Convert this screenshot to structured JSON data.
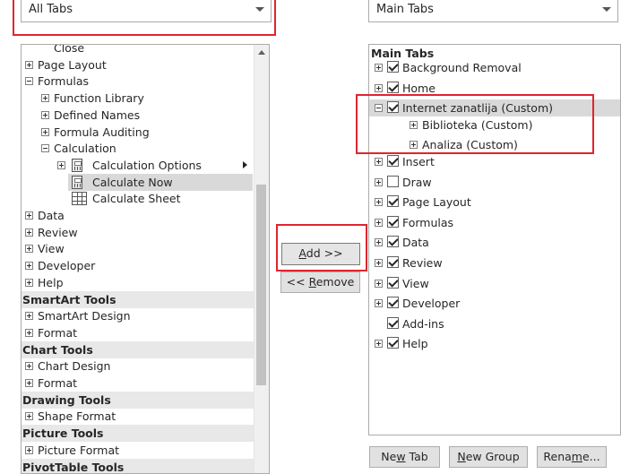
{
  "left_dropdown": {
    "value": "All Tabs"
  },
  "right_dropdown": {
    "value": "Main Tabs"
  },
  "left_tree": [
    {
      "kind": "item",
      "level": 1,
      "label": "Close",
      "expander": "none",
      "cut": true
    },
    {
      "kind": "item",
      "level": 0,
      "label": "Page Layout",
      "expander": "plus"
    },
    {
      "kind": "item",
      "level": 0,
      "label": "Formulas",
      "expander": "minus"
    },
    {
      "kind": "item",
      "level": 1,
      "label": "Function Library",
      "expander": "plus"
    },
    {
      "kind": "item",
      "level": 1,
      "label": "Defined Names",
      "expander": "plus"
    },
    {
      "kind": "item",
      "level": 1,
      "label": "Formula Auditing",
      "expander": "plus"
    },
    {
      "kind": "item",
      "level": 1,
      "label": "Calculation",
      "expander": "minus"
    },
    {
      "kind": "cmd",
      "level": 2,
      "label": "Calculation Options",
      "icon": "calculator-icon",
      "expander": "plus",
      "submenu": true
    },
    {
      "kind": "cmd",
      "level": 2,
      "label": "Calculate Now",
      "icon": "calculator-icon",
      "selected": true
    },
    {
      "kind": "cmd",
      "level": 2,
      "label": "Calculate Sheet",
      "icon": "sheet-icon"
    },
    {
      "kind": "item",
      "level": 0,
      "label": "Data",
      "expander": "plus"
    },
    {
      "kind": "item",
      "level": 0,
      "label": "Review",
      "expander": "plus"
    },
    {
      "kind": "item",
      "level": 0,
      "label": "View",
      "expander": "plus"
    },
    {
      "kind": "item",
      "level": 0,
      "label": "Developer",
      "expander": "plus"
    },
    {
      "kind": "item",
      "level": 0,
      "label": "Help",
      "expander": "plus"
    },
    {
      "kind": "group",
      "label": "SmartArt Tools"
    },
    {
      "kind": "item",
      "level": 0,
      "label": "SmartArt Design",
      "expander": "plus"
    },
    {
      "kind": "item",
      "level": 0,
      "label": "Format",
      "expander": "plus"
    },
    {
      "kind": "group",
      "label": "Chart Tools"
    },
    {
      "kind": "item",
      "level": 0,
      "label": "Chart Design",
      "expander": "plus"
    },
    {
      "kind": "item",
      "level": 0,
      "label": "Format",
      "expander": "plus"
    },
    {
      "kind": "group",
      "label": "Drawing Tools"
    },
    {
      "kind": "item",
      "level": 0,
      "label": "Shape Format",
      "expander": "plus"
    },
    {
      "kind": "group",
      "label": "Picture Tools"
    },
    {
      "kind": "item",
      "level": 0,
      "label": "Picture Format",
      "expander": "plus"
    },
    {
      "kind": "group",
      "label": "PivotTable Tools"
    }
  ],
  "right_tree_header": "Main Tabs",
  "right_tree": [
    {
      "label": "Background Removal",
      "level": 0,
      "expander": "plus",
      "checked": true
    },
    {
      "label": "Home",
      "level": 0,
      "expander": "plus",
      "checked": true
    },
    {
      "label": "Internet zanatlija (Custom)",
      "level": 0,
      "expander": "minus",
      "checked": true,
      "selected": true
    },
    {
      "label": "Biblioteka (Custom)",
      "level": 1,
      "expander": "plus"
    },
    {
      "label": "Analiza (Custom)",
      "level": 1,
      "expander": "plus"
    },
    {
      "label": "Insert",
      "level": 0,
      "expander": "plus",
      "checked": true
    },
    {
      "label": "Draw",
      "level": 0,
      "expander": "plus",
      "checked": false
    },
    {
      "label": "Page Layout",
      "level": 0,
      "expander": "plus",
      "checked": true
    },
    {
      "label": "Formulas",
      "level": 0,
      "expander": "plus",
      "checked": true
    },
    {
      "label": "Data",
      "level": 0,
      "expander": "plus",
      "checked": true
    },
    {
      "label": "Review",
      "level": 0,
      "expander": "plus",
      "checked": true
    },
    {
      "label": "View",
      "level": 0,
      "expander": "plus",
      "checked": true
    },
    {
      "label": "Developer",
      "level": 0,
      "expander": "plus",
      "checked": true
    },
    {
      "label": "Add-ins",
      "level": 0,
      "expander": "none",
      "checked": true
    },
    {
      "label": "Help",
      "level": 0,
      "expander": "plus",
      "checked": true
    }
  ],
  "buttons": {
    "add": {
      "pre": "",
      "key": "A",
      "post": "dd >>"
    },
    "remove": {
      "pre": "<< ",
      "key": "R",
      "post": "emove"
    },
    "new_tab": {
      "pre": "Ne",
      "key": "w",
      "post": " Tab"
    },
    "new_group": {
      "pre": "",
      "key": "N",
      "post": "ew Group"
    },
    "rename": {
      "pre": "Rena",
      "key": "m",
      "post": "e..."
    }
  },
  "colors": {
    "highlight_red": "#e0242f",
    "selected_bg": "#d9d9d9",
    "group_header_bg": "#e8e8e8"
  }
}
